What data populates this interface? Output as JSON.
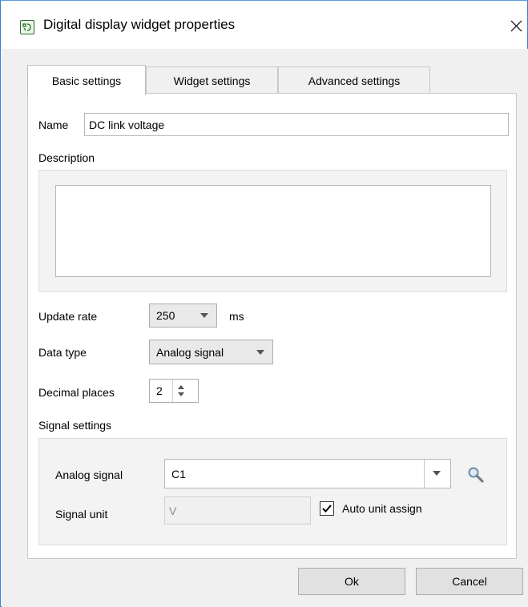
{
  "window": {
    "title": "Digital display widget properties",
    "app_icon": "widget-app-icon",
    "close_icon": "close-icon"
  },
  "tabs": [
    {
      "label": "Basic settings",
      "active": true
    },
    {
      "label": "Widget settings",
      "active": false
    },
    {
      "label": "Advanced settings",
      "active": false
    }
  ],
  "form": {
    "name_label": "Name",
    "name_value": "DC link voltage",
    "description_label": "Description",
    "description_value": "",
    "update_rate_label": "Update rate",
    "update_rate_value": "250",
    "update_rate_unit": "ms",
    "data_type_label": "Data type",
    "data_type_value": "Analog signal",
    "decimal_places_label": "Decimal places",
    "decimal_places_value": "2"
  },
  "signal_settings": {
    "section_label": "Signal settings",
    "analog_signal_label": "Analog signal",
    "analog_signal_value": "C1",
    "search_icon": "search-icon",
    "signal_unit_label": "Signal unit",
    "signal_unit_value": "V",
    "auto_unit_label": "Auto unit assign",
    "auto_unit_checked": true
  },
  "buttons": {
    "ok_label": "Ok",
    "cancel_label": "Cancel"
  }
}
